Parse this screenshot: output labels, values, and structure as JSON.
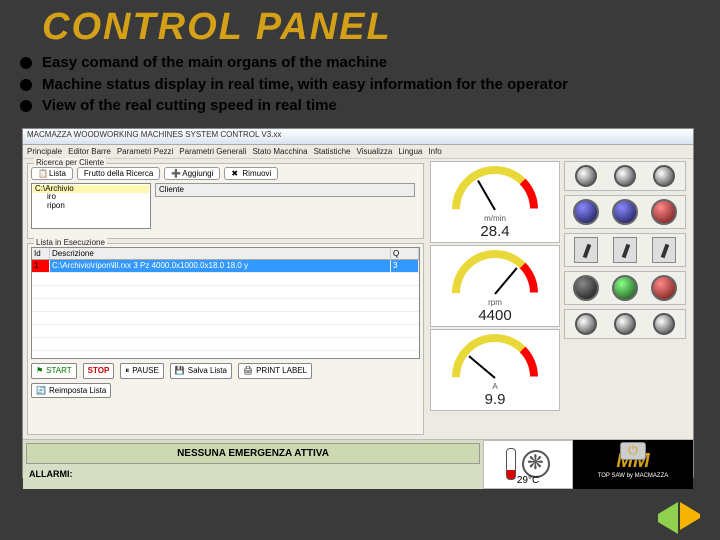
{
  "title": "CONTROL PANEL",
  "bullets": [
    "Easy comand of the main organs of the machine",
    "Machine status display in real time, with easy information for the operator",
    "View of the real cutting speed in real time"
  ],
  "window": {
    "titlebar": "MACMAZZA WOODWORKING MACHINES SYSTEM CONTROL  V3.xx",
    "menu": [
      "Principale",
      "Editor Barre",
      "Parametri Pezzi",
      "Parametri Generali",
      "Stato Macchina",
      "Statistiche",
      "Visualizza",
      "Lingua",
      "Info"
    ]
  },
  "search": {
    "frame_title": "Ricerca per Cliente",
    "btn_list": "Lista",
    "btn_filter": "Frutto della Ricerca",
    "btn_add": "Aggiungi",
    "btn_remove": "Rimuovi",
    "tree_root": "C:\\Archivio",
    "tree_items": [
      "iro",
      "ripon"
    ],
    "cliente_header": "Cliente"
  },
  "list": {
    "frame_title": "Lista in Esecuzione",
    "headers": {
      "id": "Id",
      "desc": "Descrizione",
      "qty": "Q"
    },
    "row": {
      "id": "1",
      "desc": "C:\\Archivio\\ripon\\lll.rxx   3 Pz   4000.0x1000.0x18.0   18.0  y",
      "qty": "3"
    }
  },
  "action_buttons": {
    "start": "START",
    "stop": "STOP",
    "pause": "PAUSE",
    "save": "Salva Lista",
    "print": "PRINT LABEL",
    "new": "Reimposta Lista"
  },
  "gauges": {
    "speed": {
      "unit": "m/min",
      "value": "28.4"
    },
    "rpm": {
      "unit": "rpm",
      "value": "4400"
    },
    "amp": {
      "unit": "A",
      "value": "9.9"
    }
  },
  "temperature": {
    "value": "29°C"
  },
  "emergency": {
    "banner": "NESSUNA EMERGENZA ATTIVA",
    "label": "ALLARMI:"
  },
  "brand": {
    "logo": "MM",
    "sub": "TOP SAW by MACMAZZA"
  }
}
